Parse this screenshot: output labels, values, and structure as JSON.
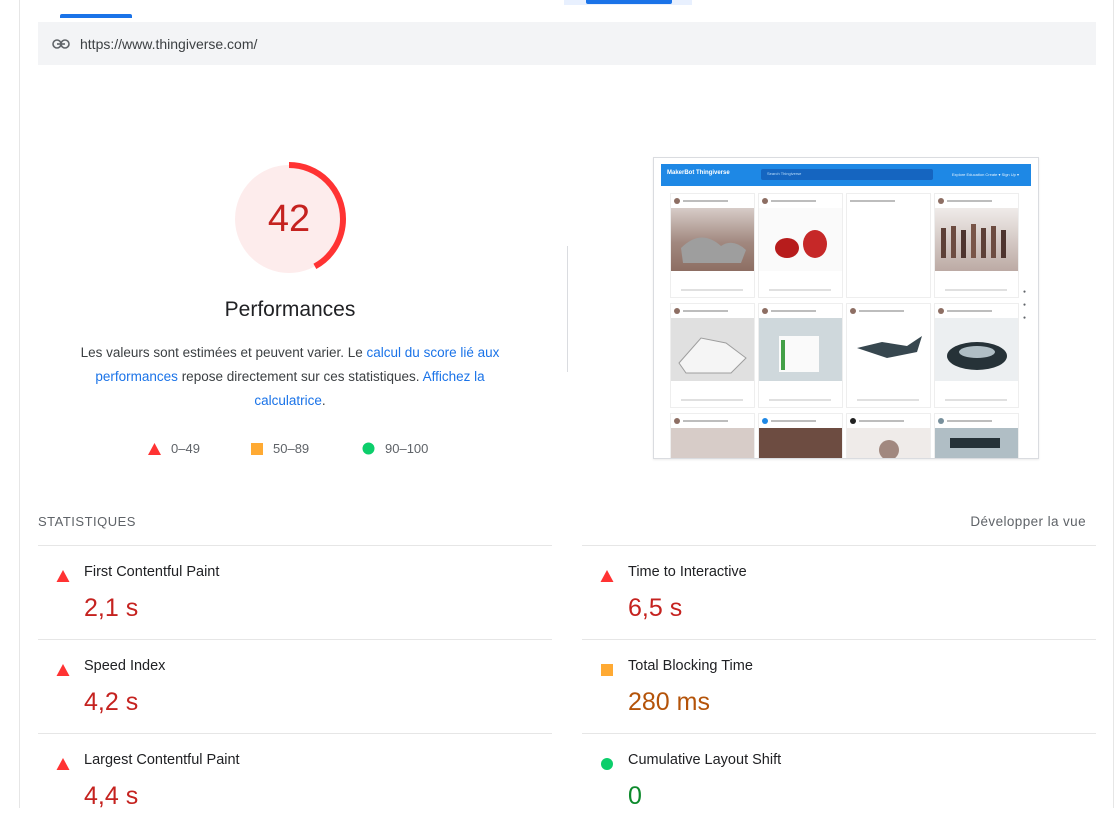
{
  "url": "https://www.thingiverse.com/",
  "score": {
    "value": "42",
    "fraction": 0.42,
    "label": "Performances",
    "color": "#ff3333"
  },
  "description": {
    "part1": "Les valeurs sont estimées et peuvent varier. Le ",
    "link1": "calcul du score lié aux performances",
    "part2": " repose directement sur ces statistiques. ",
    "link2": "Affichez la calculatrice",
    "part3": "."
  },
  "legend": {
    "fail": "0–49",
    "average": "50–89",
    "pass": "90–100"
  },
  "preview": {
    "logo": "MakerBot Thingiverse",
    "search_placeholder": "Search Thingiverse",
    "nav": "Explore   Education   Create ▾   Sign Up ▾"
  },
  "metrics": {
    "heading": "STATISTIQUES",
    "expand_label": "Développer la vue",
    "fcp": {
      "label": "First Contentful Paint",
      "value": "2,1 s",
      "status": "fail"
    },
    "tti": {
      "label": "Time to Interactive",
      "value": "6,5 s",
      "status": "fail"
    },
    "si": {
      "label": "Speed Index",
      "value": "4,2 s",
      "status": "fail"
    },
    "tbt": {
      "label": "Total Blocking Time",
      "value": "280 ms",
      "status": "average"
    },
    "lcp": {
      "label": "Largest Contentful Paint",
      "value": "4,4 s",
      "status": "fail"
    },
    "cls": {
      "label": "Cumulative Layout Shift",
      "value": "0",
      "status": "pass"
    }
  },
  "colors": {
    "fail": "#ff3333",
    "average": "#ffaa33",
    "pass": "#0cce6b",
    "link": "#1a73e8"
  }
}
